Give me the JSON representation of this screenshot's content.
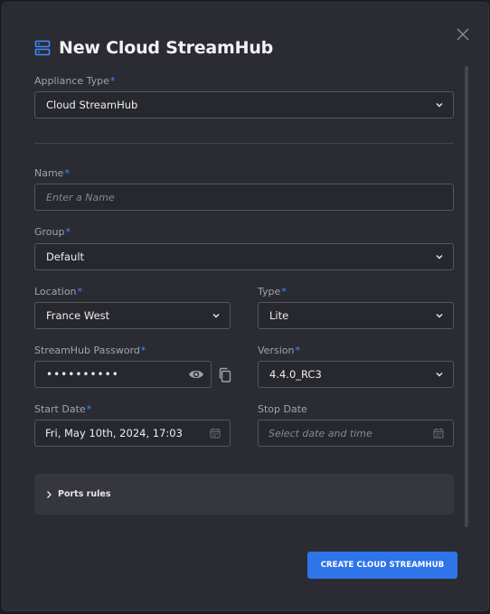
{
  "dialog": {
    "title": "New Cloud StreamHub",
    "submit_label": "CREATE CLOUD STREAMHUB"
  },
  "icons": {
    "title": "server-icon",
    "close": "close-icon",
    "select": "chevron-down-icon",
    "show_password": "eye-icon",
    "copy_password": "copy-icon",
    "date": "calendar-icon",
    "expand": "chevron-right-icon"
  },
  "form": {
    "appliance_type": {
      "label": "Appliance Type",
      "value": "Cloud StreamHub"
    },
    "name": {
      "label": "Name",
      "value": "",
      "placeholder": "Enter a Name"
    },
    "group": {
      "label": "Group",
      "value": "Default"
    },
    "location": {
      "label": "Location",
      "value": "France West"
    },
    "type": {
      "label": "Type",
      "value": "Lite"
    },
    "password": {
      "label": "StreamHub Password",
      "value": "••••••••••"
    },
    "version": {
      "label": "Version",
      "value": "4.4.0_RC3"
    },
    "start_date": {
      "label": "Start Date",
      "value": "Fri, May 10th, 2024, 17:03"
    },
    "stop_date": {
      "label": "Stop Date",
      "value": "",
      "placeholder": "Select date and time"
    },
    "required_marker": "*"
  },
  "ports": {
    "label": "Ports rules"
  },
  "colors": {
    "accent": "#2f74e9",
    "required": "#3d8bfd",
    "modal_bg": "#2b2c33",
    "field_border": "#55575f"
  }
}
